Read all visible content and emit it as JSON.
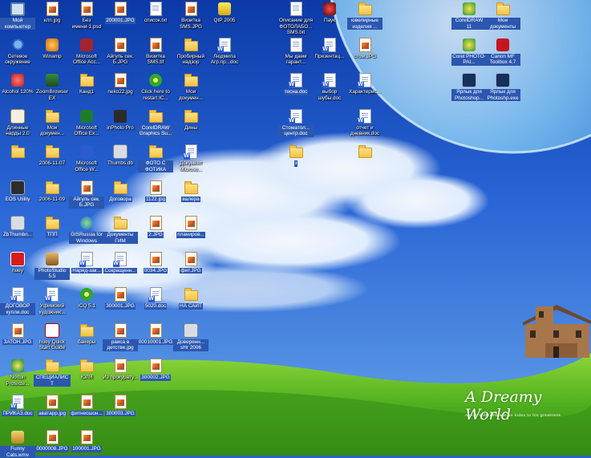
{
  "wallpaper": {
    "title": "A Dreamy World",
    "slogan": "A man's dreams are an index to his greatness"
  },
  "icons": [
    {
      "label": "Мой компьютер",
      "type": "computer",
      "selected": true
    },
    {
      "label": "Сетевое окружение",
      "type": "network",
      "selected": false
    },
    {
      "label": "Alcohol 120%",
      "type": "app-red",
      "selected": false
    },
    {
      "label": "Длинные нарды 2.0",
      "type": "app-dice",
      "selected": false
    },
    {
      "label": "",
      "type": "folder",
      "selected": false
    },
    {
      "label": "EOS Utility",
      "type": "app-camera",
      "selected": true
    },
    {
      "label": "ZbThumbn...",
      "type": "app-gray",
      "selected": true
    },
    {
      "label": "huey",
      "type": "app-huey",
      "selected": false
    },
    {
      "label": "ДОГОВОР купли.doc",
      "type": "word",
      "selected": true
    },
    {
      "label": "ЗАТОН.JPG",
      "type": "jpg",
      "selected": true
    },
    {
      "label": "Norton Protecte...",
      "type": "app-norton",
      "selected": false
    },
    {
      "label": "ПРИКАЗ.doc",
      "type": "word",
      "selected": true
    },
    {
      "label": "Funny Cats.wmv",
      "type": "app-media",
      "selected": true
    },
    {
      "label": "клп.jpg",
      "type": "jpg",
      "selected": false
    },
    {
      "label": "Winamp",
      "type": "app-winamp",
      "selected": false
    },
    {
      "label": "ZoomBrowser EX",
      "type": "app-zoom",
      "selected": false
    },
    {
      "label": "Мои докумен...",
      "type": "folder",
      "selected": false
    },
    {
      "label": "2006-11-07",
      "type": "folder",
      "selected": false
    },
    {
      "label": "2006-11-09",
      "type": "folder",
      "selected": false
    },
    {
      "label": "ТПП",
      "type": "folder",
      "selected": true
    },
    {
      "label": "PhotoStudio 5.5",
      "type": "app-photostudio",
      "selected": true
    },
    {
      "label": "Уфимский художник...",
      "type": "word",
      "selected": false
    },
    {
      "label": "huey Quick Start Guide",
      "type": "app-pdf",
      "selected": false
    },
    {
      "label": "СПЕЦИАЛИСТ",
      "type": "folder",
      "selected": true
    },
    {
      "label": "аватарр.jpg",
      "type": "jpg",
      "selected": true
    },
    {
      "label": "0000008.JPG",
      "type": "jpg",
      "selected": true
    },
    {
      "label": "Без имени-1.psd",
      "type": "jpg",
      "selected": false
    },
    {
      "label": "Microsoft Office Acc...",
      "type": "app-access",
      "selected": false
    },
    {
      "label": "Канд1",
      "type": "folder",
      "selected": false
    },
    {
      "label": "Microsoft Office Ex...",
      "type": "app-excel",
      "selected": false
    },
    {
      "label": "Microsoft Office W...",
      "type": "app-word",
      "selected": false
    },
    {
      "label": "Айгуль сек. Б.JPG",
      "type": "jpg",
      "selected": true
    },
    {
      "label": "GISRussia for Windows",
      "type": "app-globe",
      "selected": true
    },
    {
      "label": "Наряд-зак...",
      "type": "word",
      "selected": true
    },
    {
      "label": "ICQ 5.1",
      "type": "app-icq",
      "selected": false
    },
    {
      "label": "банеры",
      "type": "folder",
      "selected": false
    },
    {
      "label": "ЮЛЯ",
      "type": "folder",
      "selected": false
    },
    {
      "label": "фитнесшон...",
      "type": "jpg",
      "selected": true
    },
    {
      "label": "100001.JPG",
      "type": "jpg",
      "selected": true
    },
    {
      "label": "200001.JPG",
      "type": "jpg",
      "selected": true
    },
    {
      "label": "Айгуль сек. Б.JPG",
      "type": "jpg",
      "selected": false
    },
    {
      "label": "neko22.jpg",
      "type": "jpg",
      "selected": false
    },
    {
      "label": "inPhoto Pro",
      "type": "app-inphoto",
      "selected": false
    },
    {
      "label": "Thumbs.db",
      "type": "app-gray",
      "selected": false
    },
    {
      "label": "Договора",
      "type": "folder",
      "selected": true
    },
    {
      "label": "Документы ГИМ",
      "type": "folder",
      "selected": true
    },
    {
      "label": "Сокращенн...",
      "type": "word",
      "selected": true
    },
    {
      "label": "300001.JPG",
      "type": "jpg",
      "selected": true
    },
    {
      "label": "раиса в детстве.jpg",
      "type": "jpg",
      "selected": true
    },
    {
      "label": "Из прокурату...",
      "type": "jpg",
      "selected": false
    },
    {
      "label": "300003.JPG",
      "type": "jpg",
      "selected": true
    },
    {
      "label": "список.txt",
      "type": "doc",
      "selected": false
    },
    {
      "label": "Визитка SMS.tif",
      "type": "jpg",
      "selected": false
    },
    {
      "label": "Click here to restart IC...",
      "type": "app-icq",
      "selected": false
    },
    {
      "label": "CorelDRAW Graphics Su...",
      "type": "folder",
      "selected": true
    },
    {
      "label": "ФОТО С ФОТИКА",
      "type": "folder",
      "selected": true
    },
    {
      "label": "1122.jpg",
      "type": "jpg",
      "selected": true
    },
    {
      "label": "2.JPG",
      "type": "jpg",
      "selected": true
    },
    {
      "label": "0034.JPG",
      "type": "jpg",
      "selected": true
    },
    {
      "label": "5020.doc",
      "type": "word",
      "selected": true
    },
    {
      "label": "00010001.JPG",
      "type": "jpg",
      "selected": true
    },
    {
      "label": "300002.JPG",
      "type": "jpg",
      "selected": true
    },
    {
      "label": "Визитка SMS.JPG",
      "type": "jpg",
      "selected": false
    },
    {
      "label": "Пробирный надзор",
      "type": "folder",
      "selected": false
    },
    {
      "label": "Мои докумен...",
      "type": "folder",
      "selected": false
    },
    {
      "label": "Дины",
      "type": "folder",
      "selected": false
    },
    {
      "label": "Документ Microso...",
      "type": "word",
      "selected": false
    },
    {
      "label": "валера",
      "type": "folder",
      "selected": true
    },
    {
      "label": "планиров...",
      "type": "jpg",
      "selected": true
    },
    {
      "label": "фит.JPG",
      "type": "jpg",
      "selected": true
    },
    {
      "label": "НА САЙТ",
      "type": "folder",
      "selected": true
    },
    {
      "label": "Доверенн... sHr 2006",
      "type": "app-gray",
      "selected": true
    },
    {
      "label": "QIP 2005",
      "type": "app-qip",
      "selected": false
    },
    {
      "label": "Людмила Агр.пр...doc",
      "type": "word",
      "selected": false
    },
    {
      "label": "Описание для ФОТОЛАБО... SMS.txt",
      "type": "doc",
      "selected": false
    },
    {
      "label": "Мы даем гарант...",
      "type": "doc",
      "selected": false
    },
    {
      "label": "тесна.doc",
      "type": "word",
      "selected": true
    },
    {
      "label": "Стоматол... центр.doc",
      "type": "word",
      "selected": true
    },
    {
      "label": "з",
      "type": "folder",
      "selected": true
    },
    {
      "label": "Паук",
      "type": "app-spider",
      "selected": false
    },
    {
      "label": "Презентац...",
      "type": "word",
      "selected": false
    },
    {
      "label": "выбор шубы.doc",
      "type": "word",
      "selected": false
    },
    {
      "label": "ювелирные изделия ...",
      "type": "folder",
      "selected": true
    },
    {
      "label": "стом.JPG",
      "type": "jpg",
      "selected": false
    },
    {
      "label": "Характерис...",
      "type": "word",
      "selected": false
    },
    {
      "label": "отчет и дневник.doc",
      "type": "word",
      "selected": false
    },
    {
      "label": "",
      "type": "folder",
      "selected": false
    },
    {
      "label": "CorelDRAW 11",
      "type": "app-corel",
      "selected": true
    },
    {
      "label": "Corel PHOTO-PAI...",
      "type": "app-corel",
      "selected": true
    },
    {
      "label": "Ярлык для Photoshop...",
      "type": "app-ps",
      "selected": true
    },
    {
      "label": "Мои документы",
      "type": "folder",
      "selected": true
    },
    {
      "label": "Canon MF Toolbox 4.7",
      "type": "app-canon",
      "selected": true
    },
    {
      "label": "Ярлык для Photoshp.exe",
      "type": "app-ps",
      "selected": true
    }
  ]
}
